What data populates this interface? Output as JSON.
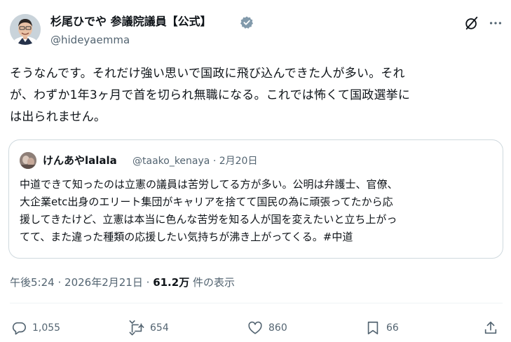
{
  "author": {
    "name": "杉尾ひでや 参議院議員【公式】",
    "handle": "@hideyaemma",
    "verified": true
  },
  "post": {
    "text_lines": [
      "そうなんです。それだけ強い思いで国政に飛び込んできた人が多い。それ",
      "が、わずか1年3ヶ月で首を切られ無職になる。これでは怖くて国政選挙に",
      "は出られません。"
    ]
  },
  "quote": {
    "name": "けんあやlalala",
    "handle": "@taako_kenaya",
    "separator": "·",
    "date": "2月20日",
    "text_lines": [
      "中道できて知ったのは立憲の議員は苦労してる方が多い。公明は弁護士、官僚、",
      "大企業etc出身のエリート集団がキャリアを捨てて国民の為に頑張ってたから応",
      "援してきたけど、立憲は本当に色んな苦労を知る人が国を変えたいと立ち上がっ",
      "てて、また違った種類の応援したい気持ちが沸き上がってくる。#中道"
    ]
  },
  "meta": {
    "time": "午後5:24",
    "separator": "·",
    "date": "2026年2月21日",
    "views_count": "61.2万",
    "views_label": "件の表示"
  },
  "actions": {
    "reply_count": "1,055",
    "repost_count": "654",
    "like_count": "860",
    "bookmark_count": "66"
  },
  "icons": {
    "verified": "verified-badge-icon",
    "grok": "grok-icon",
    "more": "more-icon",
    "reply": "reply-icon",
    "repost": "repost-icon",
    "like": "heart-icon",
    "bookmark": "bookmark-icon",
    "share": "share-icon"
  },
  "colors": {
    "text": "#0f1419",
    "secondary": "#536471",
    "border": "#cfd9de",
    "verified": "#829aab"
  }
}
